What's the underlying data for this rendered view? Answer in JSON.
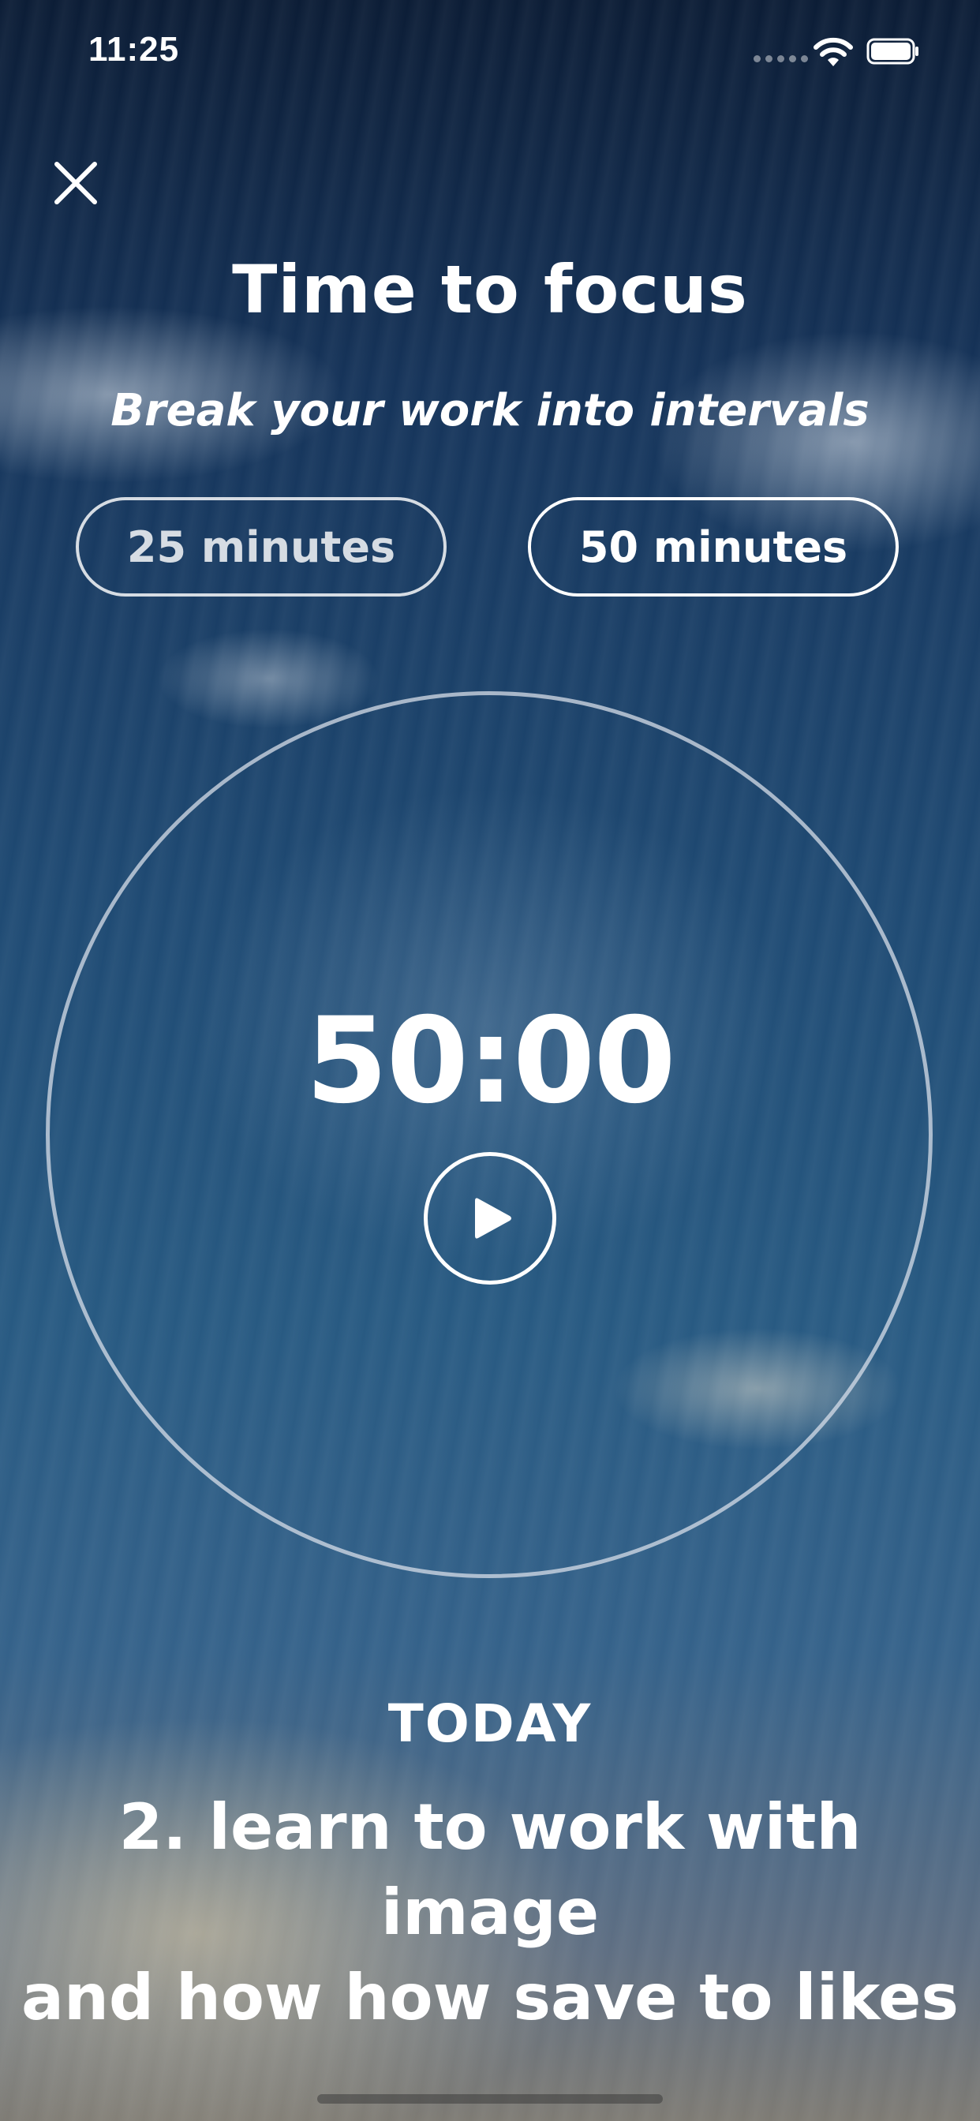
{
  "status_bar": {
    "time": "11:25",
    "signal_icon": "signal-dots-icon",
    "wifi_icon": "wifi-icon",
    "battery_icon": "battery-icon"
  },
  "header": {
    "close_icon": "close-icon",
    "title": "Time to focus",
    "subtitle": "Break your work into intervals"
  },
  "durations": {
    "option_1": "25 minutes",
    "option_2": "50 minutes"
  },
  "timer": {
    "display": "50:00",
    "play_icon": "play-icon"
  },
  "today": {
    "label": "TODAY",
    "task_line_1": "2. learn to work with image",
    "task_line_2": "and how how save to likes"
  },
  "colors": {
    "text": "#ffffff",
    "sky_dark": "#0c1d36",
    "sky_mid": "#1f4a73",
    "cloud": "#dce4ec"
  }
}
